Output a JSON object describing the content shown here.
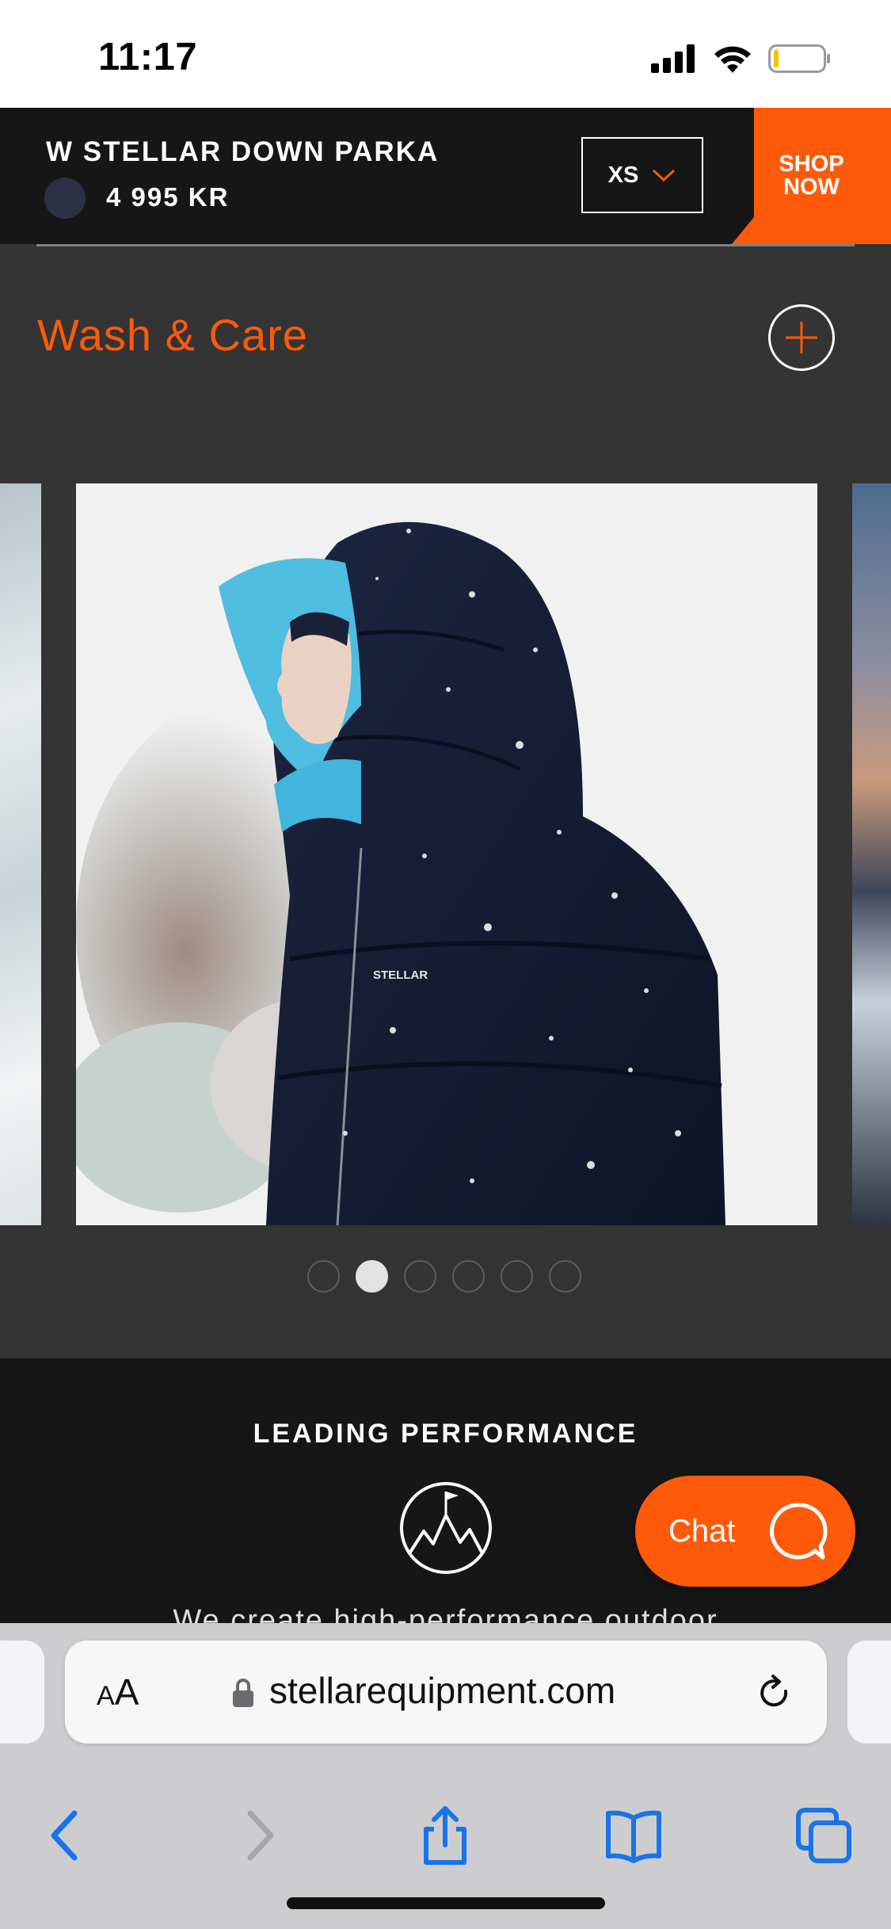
{
  "status_bar": {
    "time": "11:17"
  },
  "product_bar": {
    "name": "W STELLAR DOWN PARKA",
    "price": "4 995 KR",
    "swatch_color": "#2d3044",
    "size": "XS",
    "shop_now_label": "SHOP NOW"
  },
  "accordion": {
    "title": "Wash & Care"
  },
  "carousel": {
    "slide_count": 6,
    "active_index": 1,
    "logo_text": "STELLAR"
  },
  "performance": {
    "title": "LEADING PERFORMANCE",
    "text": "We create high-performance outdoor"
  },
  "chat": {
    "label": "Chat"
  },
  "browser": {
    "aa_small": "A",
    "aa_large": "A",
    "url": "stellarequipment.com"
  },
  "colors": {
    "accent": "#ff5a0a",
    "header_bg": "#161616",
    "page_bg": "#343434",
    "ios_blue": "#1a73e8"
  }
}
